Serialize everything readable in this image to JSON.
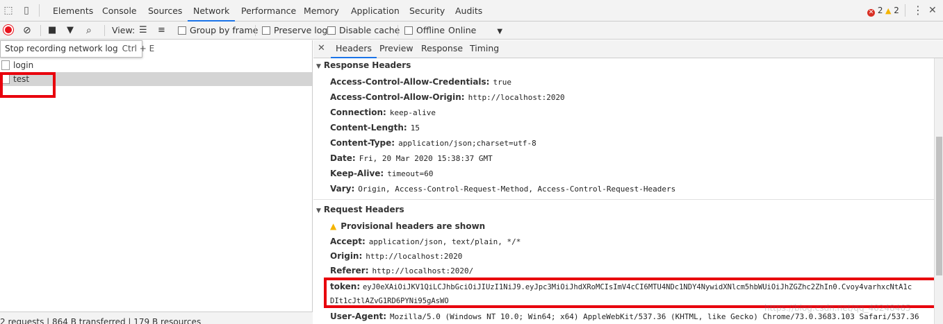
{
  "top_tabs": [
    "Elements",
    "Console",
    "Sources",
    "Network",
    "Performance",
    "Memory",
    "Application",
    "Security",
    "Audits"
  ],
  "active_tab": "Network",
  "errors_count": "2",
  "warnings_count": "2",
  "toolbar": {
    "view_label": "View:",
    "group_by_frame": "Group by frame",
    "preserve_log": "Preserve log",
    "disable_cache": "Disable cache",
    "offline": "Offline",
    "throttle": "Online"
  },
  "tooltip": {
    "text": "Stop recording network log",
    "shortcut": "Ctrl + E"
  },
  "requests": [
    {
      "name": "login"
    },
    {
      "name": "test"
    }
  ],
  "statusbar": "2 requests  |  864 B transferred  |  179 B resources",
  "detail_tabs": [
    "Headers",
    "Preview",
    "Response",
    "Timing"
  ],
  "response_headers_title": "Response Headers",
  "response_headers": [
    {
      "k": "Access-Control-Allow-Credentials:",
      "v": "true"
    },
    {
      "k": "Access-Control-Allow-Origin:",
      "v": "http://localhost:2020"
    },
    {
      "k": "Connection:",
      "v": "keep-alive"
    },
    {
      "k": "Content-Length:",
      "v": "15"
    },
    {
      "k": "Content-Type:",
      "v": "application/json;charset=utf-8"
    },
    {
      "k": "Date:",
      "v": "Fri, 20 Mar 2020 15:38:37 GMT"
    },
    {
      "k": "Keep-Alive:",
      "v": "timeout=60"
    },
    {
      "k": "Vary:",
      "v": "Origin, Access-Control-Request-Method, Access-Control-Request-Headers"
    }
  ],
  "request_headers_title": "Request Headers",
  "provisional": "Provisional headers are shown",
  "request_headers": [
    {
      "k": "Accept:",
      "v": "application/json, text/plain, */*"
    },
    {
      "k": "Origin:",
      "v": "http://localhost:2020"
    },
    {
      "k": "Referer:",
      "v": "http://localhost:2020/"
    }
  ],
  "token": {
    "k": "token:",
    "v1": "eyJ0eXAiOiJKV1QiLCJhbGciOiJIUzI1NiJ9.eyJpc3MiOiJhdXRoMCIsImV4cCI6MTU4NDc1NDY4NywidXNlcm5hbWUiOiJhZGZhc2ZhIn0.Cvoy4varhxcNtA1c",
    "v2": "DIt1cJtlAZvG1RD6PYNi95gAsWO"
  },
  "user_agent": {
    "k": "User-Agent:",
    "v": "Mozilla/5.0 (Windows NT 10.0; Win64; x64) AppleWebKit/537.36 (KHTML, like Gecko) Chrome/73.0.3683.103 Safari/537.36"
  },
  "watermark": "https://blog.csdn.net/qq_40248465",
  "colors": {
    "accent": "#1a73e8",
    "record": "#e8131d",
    "highlight": "#e8000c"
  }
}
